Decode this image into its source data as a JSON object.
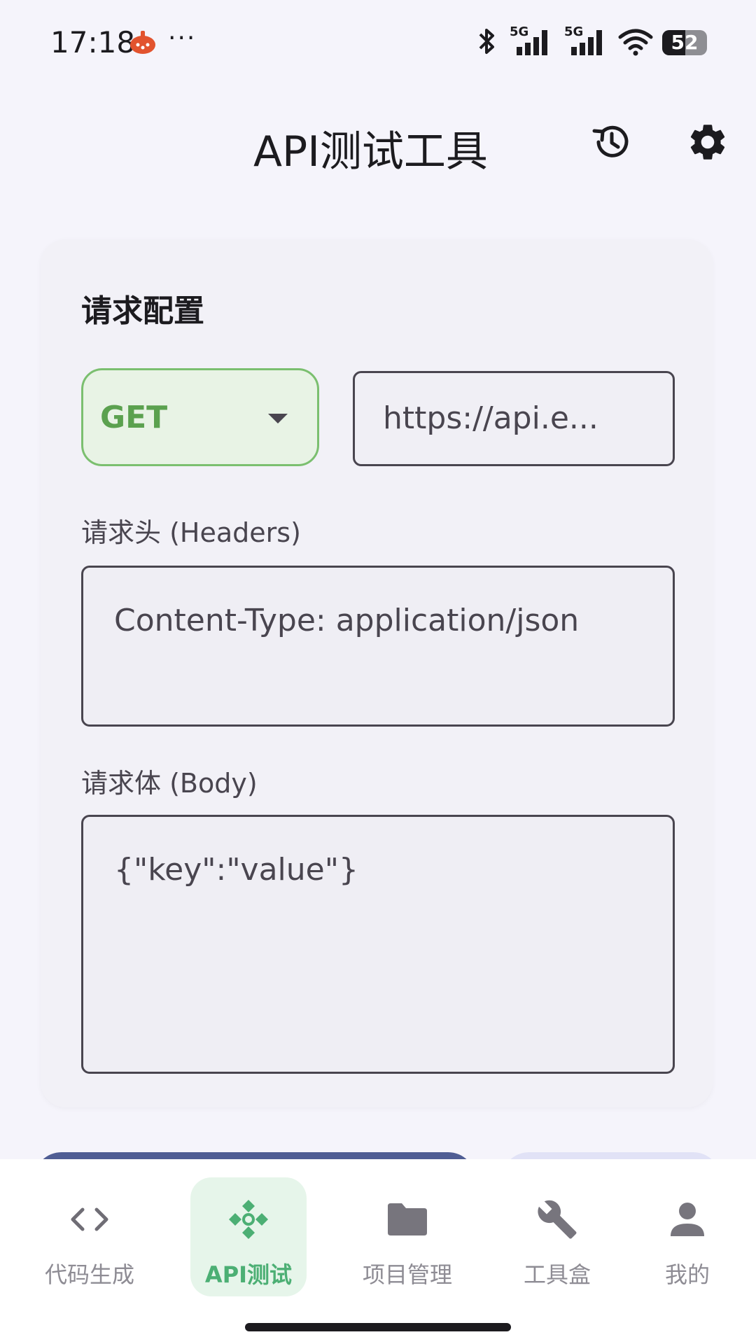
{
  "status_bar": {
    "time": "17:18",
    "dots": "···",
    "network_1": "5G",
    "network_2": "5G",
    "battery_level": 52,
    "battery_text": "52"
  },
  "app_bar": {
    "title": "API测试工具"
  },
  "request_config": {
    "title": "请求配置",
    "method": "GET",
    "url": "https://api.e...",
    "headers_label": "请求头 (Headers)",
    "headers_value": "Content-Type: application/json",
    "body_label": "请求体 (Body)",
    "body_value": "{\"key\":\"value\"}"
  },
  "bottom_nav": {
    "items": [
      {
        "label": "代码生成",
        "icon": "code-icon"
      },
      {
        "label": "API测试",
        "icon": "api-icon",
        "active": true
      },
      {
        "label": "项目管理",
        "icon": "folder-icon"
      },
      {
        "label": "工具盒",
        "icon": "wrench-icon"
      },
      {
        "label": "我的",
        "icon": "person-icon"
      }
    ]
  },
  "colors": {
    "accent_green": "#4caf74",
    "method_green": "#5ba14f",
    "primary_button": "#4f5d94",
    "secondary_button": "#e1e2f6"
  }
}
